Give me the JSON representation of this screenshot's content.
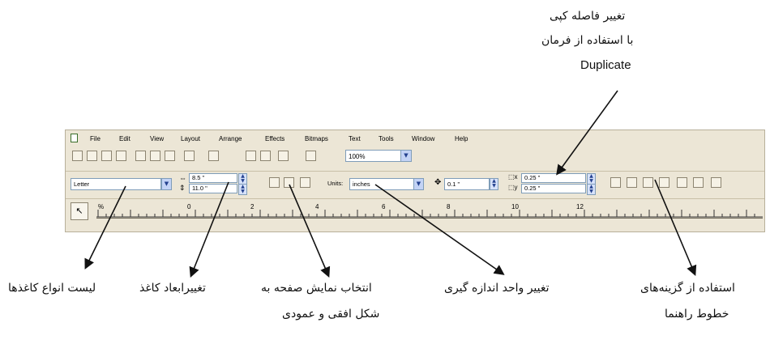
{
  "menu": {
    "items": [
      "File",
      "Edit",
      "View",
      "Layout",
      "Arrange",
      "Effects",
      "Bitmaps",
      "Text",
      "Tools",
      "Window",
      "Help"
    ]
  },
  "toolbar": {
    "zoom_value": "100%"
  },
  "propbar": {
    "paper_type": "Letter",
    "width": "8.5 \"",
    "height": "11.0 \"",
    "units_label": "Units:",
    "units_value": "inches",
    "nudge": "0.1 \"",
    "dup_x": "0.25 \"",
    "dup_y": "0.25 \""
  },
  "ruler": {
    "numbers": [
      "%",
      "0",
      "2",
      "4",
      "6",
      "8",
      "10",
      "12"
    ]
  },
  "annotations": {
    "duplicate_line1": "تغییر فاصله کپی",
    "duplicate_line2": "با استفاده از فرمان",
    "duplicate_line3": "Duplicate",
    "paper_list": "لیست انواع کاغذها",
    "paper_dims": "تغییرابعاد کاغذ",
    "orientation_line1": "انتخاب نمایش صفحه به",
    "orientation_line2": "شکل افقی و عمودی",
    "units": "تغییر واحد اندازه گیری",
    "guides_line1": "استفاده از گزینه‌های",
    "guides_line2": "خطوط راهنما"
  }
}
